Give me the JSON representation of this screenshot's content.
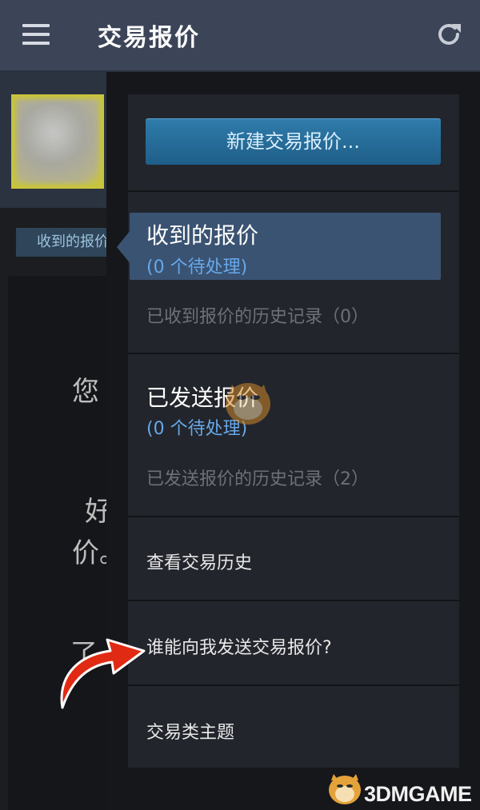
{
  "header": {
    "title": "交易报价",
    "menu_icon": "hamburger-menu-icon",
    "refresh_icon": "refresh-icon"
  },
  "background_page": {
    "tab_label": "收到的报价",
    "text_fragments": [
      "您",
      "好",
      "价。",
      "了"
    ]
  },
  "drawer": {
    "new_offer_button": "新建交易报价...",
    "received": {
      "title": "收到的报价",
      "pending": "(0 个待处理)",
      "history": "已收到报价的历史记录（0）"
    },
    "sent": {
      "title": "已发送报价",
      "pending": "(0 个待处理)",
      "history": "已发送报价的历史记录（2）"
    },
    "menu_items": [
      "查看交易历史",
      "谁能向我发送交易报价?",
      "交易类主题"
    ]
  },
  "watermark": {
    "text": "3DMGAME"
  },
  "colors": {
    "header_bg": "#3b4557",
    "accent_button": "#2f7cab",
    "selected_tab": "#3b5373",
    "pending_text": "#66a8e8",
    "annotation_arrow": "#e02a14"
  }
}
